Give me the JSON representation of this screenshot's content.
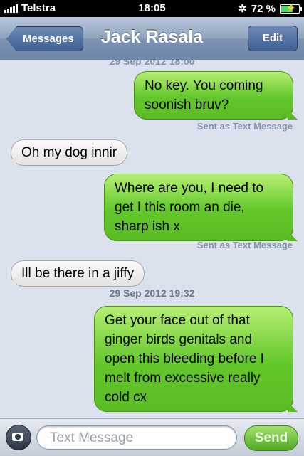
{
  "status_bar": {
    "carrier": "Telstra",
    "time": "18:05",
    "battery": "72 %",
    "battery_level": 0.72
  },
  "nav": {
    "back_label": "Messages",
    "title": "Jack Rasala",
    "edit_label": "Edit"
  },
  "thread": {
    "top_stamp": "29 Sep 2012 18:00",
    "messages": [
      {
        "dir": "out",
        "text_lines": [
          "No key. You coming",
          "soonish bruv?"
        ],
        "status": "Sent as Text Message"
      },
      {
        "dir": "in",
        "text": "Oh my dog innir"
      },
      {
        "dir": "out",
        "text_lines": [
          "Where are you, I need to",
          "get I this room an die,",
          "sharp ish x"
        ],
        "status": "Sent as Text Message"
      },
      {
        "dir": "in",
        "text": "Ill be there in a jiffy"
      },
      {
        "stamp": "29 Sep 2012 19:32"
      },
      {
        "dir": "out",
        "text_lines": [
          "Get your face out of that",
          "ginger birds genitals and",
          "open this bleeding before I",
          "melt from excessive really",
          "cold cx"
        ]
      }
    ]
  },
  "composer": {
    "placeholder": "Text Message",
    "send_label": "Send",
    "camera_icon": "camera-icon"
  }
}
